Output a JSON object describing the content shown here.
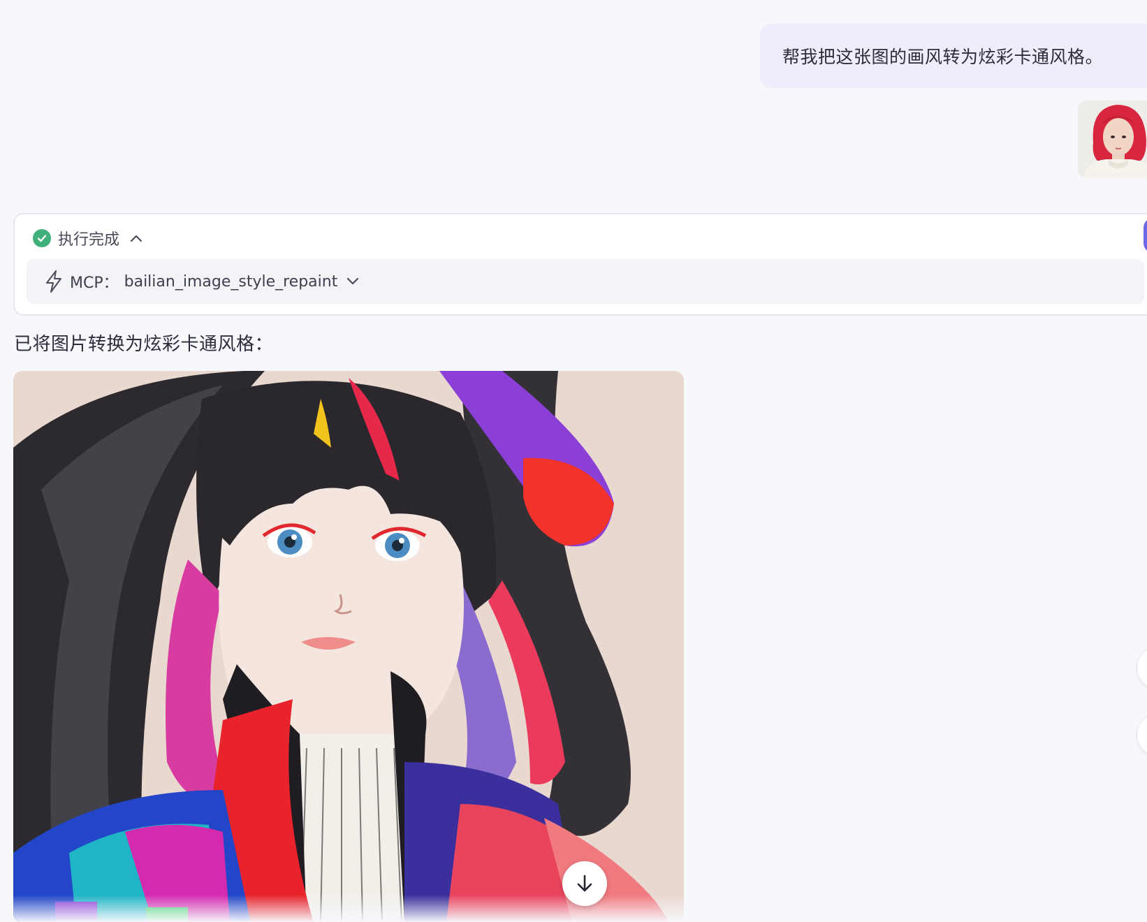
{
  "conversation": {
    "user_message": "帮我把这张图的画风转为炫彩卡通风格。",
    "user_image_icon": "portrait-photo-thumbnail"
  },
  "execution": {
    "status_label": "执行完成",
    "status_icon": "check-circle-icon",
    "status_color": "#3fb07a",
    "tool_prefix": "MCP：",
    "tool_name": "bailian_image_style_repaint"
  },
  "reply": {
    "text": "已将图片转换为炫彩卡通风格：",
    "image_icon": "cartoon-portrait-image"
  },
  "controls": {
    "scroll_down_icon": "arrow-down-icon"
  },
  "colors": {
    "accent": "#6b68e6",
    "user_bubble": "#eeedfb",
    "background": "#f7f8fc"
  }
}
